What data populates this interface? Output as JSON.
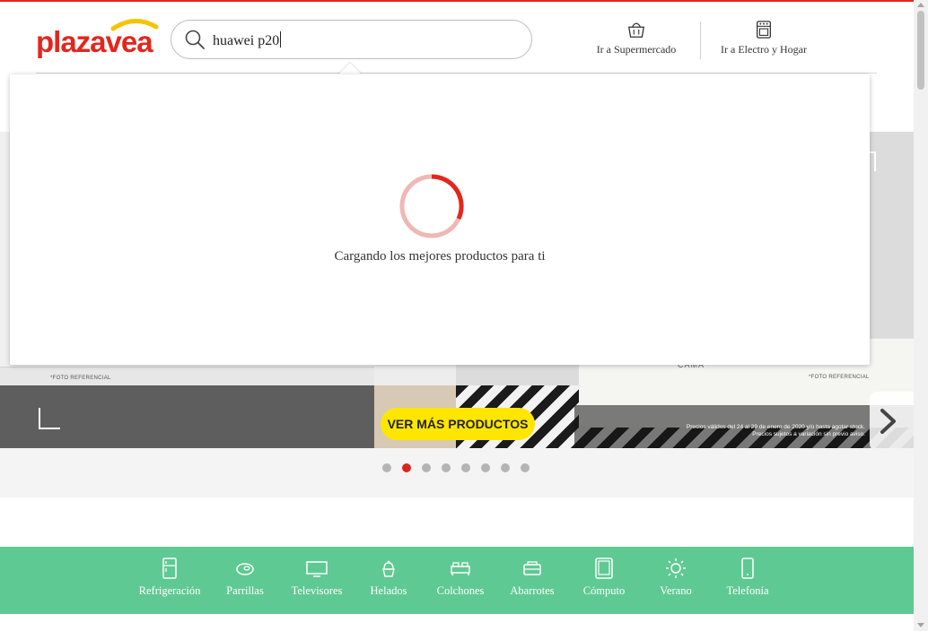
{
  "header": {
    "logo_text": "plazavea",
    "search": {
      "value": "huawei p20",
      "placeholder": ""
    },
    "links": [
      {
        "label": "Ir a Supermercado",
        "icon": "basket-icon"
      },
      {
        "label": "Ir a Electro y Hogar",
        "icon": "stove-icon"
      }
    ]
  },
  "dropdown": {
    "loading_text": "Cargando los mejores productos para ti"
  },
  "hero": {
    "cta_label": "VER MÁS PRODUCTOS",
    "foto_referencial_left": "*FOTO REFERENCIAL",
    "foto_referencial_right": "*FOTO REFERENCIAL",
    "brand_text": "CAMA",
    "legal_line1": "Precios válidos del 24 al 29 de enero de 2020 y/o hasta agotar stock.",
    "legal_line2": "Precios sujetos a variación sin previo aviso.",
    "carousel_total": 8,
    "carousel_active": 2
  },
  "categories": [
    {
      "label": "Refrigeración",
      "icon": "fridge-icon"
    },
    {
      "label": "Parrillas",
      "icon": "grill-meat-icon"
    },
    {
      "label": "Televisores",
      "icon": "tv-icon"
    },
    {
      "label": "Helados",
      "icon": "ice-cream-icon"
    },
    {
      "label": "Colchones",
      "icon": "bed-icon"
    },
    {
      "label": "Abarrotes",
      "icon": "groceries-icon"
    },
    {
      "label": "Cómputo",
      "icon": "tablet-icon"
    },
    {
      "label": "Verano",
      "icon": "sun-icon"
    },
    {
      "label": "Telefonía",
      "icon": "phone-icon"
    }
  ],
  "colors": {
    "brand_red": "#e4261d",
    "category_green": "#5fc993",
    "cta_yellow": "#ffe600",
    "dot_active": "#d7261e"
  }
}
